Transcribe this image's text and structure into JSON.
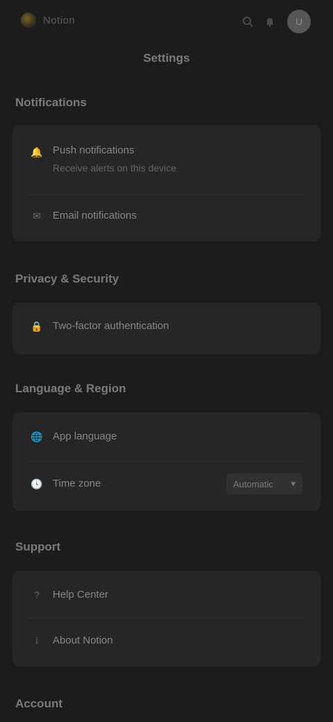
{
  "topbar": {
    "app_name": "Notion",
    "icons": [
      "search-icon",
      "bell-icon"
    ],
    "avatar_initial": "U"
  },
  "page": {
    "title": "Settings"
  },
  "sections": [
    {
      "title": "Notifications",
      "items": [
        {
          "icon": "bell-icon",
          "label": "Push notifications",
          "sub": "Receive alerts on this device"
        },
        {
          "icon": "mail-icon",
          "label": "Email notifications"
        }
      ]
    },
    {
      "title": "Privacy & Security",
      "items": [
        {
          "icon": "lock-icon",
          "label": "Two-factor authentication"
        }
      ]
    },
    {
      "title": "Language & Region",
      "items": [
        {
          "icon": "globe-icon",
          "label": "App language"
        },
        {
          "icon": "clock-icon",
          "label": "Time zone",
          "value": "Automatic"
        }
      ]
    },
    {
      "title": "Support",
      "items": [
        {
          "icon": "help-icon",
          "label": "Help Center"
        },
        {
          "icon": "info-icon",
          "label": "About Notion"
        }
      ]
    },
    {
      "title": "Account"
    }
  ],
  "colors": {
    "background": "#1c1c1c",
    "card": "#262626",
    "accent": "#7a6428"
  }
}
